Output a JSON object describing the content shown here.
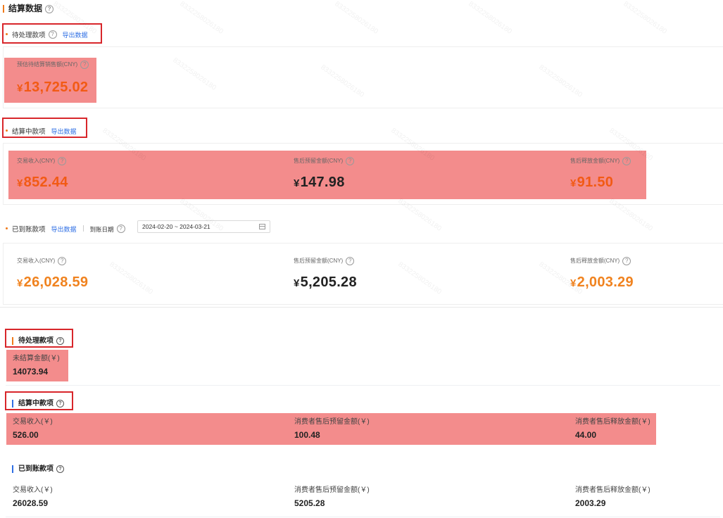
{
  "panel1": {
    "title": "结算数据",
    "pending": {
      "label": "待处理款项",
      "export": "导出数据",
      "metric_label": "预估待结算销售额(CNY)",
      "value": "13,725.02"
    },
    "settling": {
      "label": "结算中款项",
      "export": "导出数据",
      "metrics": [
        {
          "label": "交易收入(CNY)",
          "value": "852.44"
        },
        {
          "label": "售后预留金额(CNY)",
          "value": "147.98"
        },
        {
          "label": "售后释放金额(CNY)",
          "value": "91.50"
        }
      ]
    },
    "received": {
      "label": "已到账款项",
      "export": "导出数据",
      "date_label": "到账日期",
      "date_range": "2024-02-20 ~ 2024-03-21",
      "metrics": [
        {
          "label": "交易收入(CNY)",
          "value": "26,028.59"
        },
        {
          "label": "售后预留金额(CNY)",
          "value": "5,205.28"
        },
        {
          "label": "售后释放金额(CNY)",
          "value": "2,003.29"
        }
      ]
    },
    "currency_symbol": "¥",
    "watermark": "8332258026180"
  },
  "panel2": {
    "pending": {
      "label": "待处理款项",
      "metric_label": "未结算金额(￥)",
      "value": "14073.94"
    },
    "settling": {
      "label": "结算中款项",
      "metrics": [
        {
          "label": "交易收入(￥)",
          "value": "526.00"
        },
        {
          "label": "消费者售后预留金额(￥)",
          "value": "100.48"
        },
        {
          "label": "消费者售后释放金额(￥)",
          "value": "44.00"
        }
      ]
    },
    "received": {
      "label": "已到账款项",
      "metrics": [
        {
          "label": "交易收入(￥)",
          "value": "26028.59"
        },
        {
          "label": "消费者售后预留金额(￥)",
          "value": "5205.28"
        },
        {
          "label": "消费者售后释放金额(￥)",
          "value": "2003.29"
        }
      ]
    }
  },
  "icons": {
    "help": "question-circle-icon",
    "calendar": "calendar-icon"
  },
  "colors": {
    "accent_orange": "#f25a14",
    "link_blue": "#2f6fe4",
    "annotation_red": "#d8262b",
    "highlight": "#f08080"
  }
}
